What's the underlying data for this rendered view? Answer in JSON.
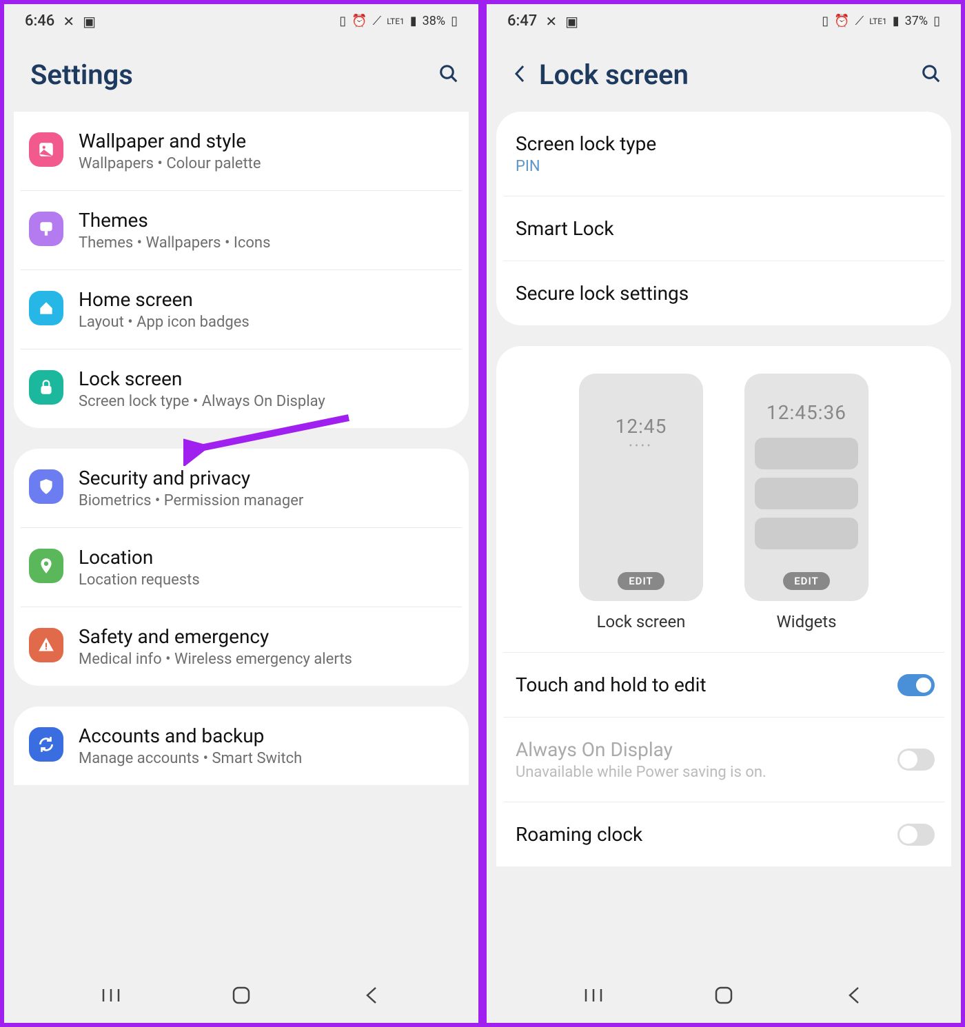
{
  "left": {
    "status": {
      "time": "6:46",
      "battery": "38%",
      "net": "LTE1"
    },
    "header": {
      "title": "Settings"
    },
    "group1": [
      {
        "title": "Wallpaper and style",
        "sub": "Wallpapers  •  Colour palette",
        "color": "#f25a8e",
        "icon": "picture"
      },
      {
        "title": "Themes",
        "sub": "Themes  •  Wallpapers  •  Icons",
        "color": "#b47af0",
        "icon": "brush"
      },
      {
        "title": "Home screen",
        "sub": "Layout  •  App icon badges",
        "color": "#26b7e6",
        "icon": "home"
      },
      {
        "title": "Lock screen",
        "sub": "Screen lock type  •  Always On Display",
        "color": "#1bb89e",
        "icon": "lock",
        "arrow": true
      }
    ],
    "group2": [
      {
        "title": "Security and privacy",
        "sub": "Biometrics  •  Permission manager",
        "color": "#6b7df0",
        "icon": "shield"
      },
      {
        "title": "Location",
        "sub": "Location requests",
        "color": "#5ab85a",
        "icon": "pin"
      },
      {
        "title": "Safety and emergency",
        "sub": "Medical info  •  Wireless emergency alerts",
        "color": "#e06a4a",
        "icon": "alert"
      }
    ],
    "group3": [
      {
        "title": "Accounts and backup",
        "sub": "Manage accounts  •  Smart Switch",
        "color": "#3a6de0",
        "icon": "sync"
      }
    ]
  },
  "right": {
    "status": {
      "time": "6:47",
      "battery": "37%",
      "net": "LTE1"
    },
    "header": {
      "title": "Lock screen"
    },
    "group1": [
      {
        "title": "Screen lock type",
        "sub": "PIN",
        "arrow": true
      },
      {
        "title": "Smart Lock"
      },
      {
        "title": "Secure lock settings"
      }
    ],
    "previews": {
      "left": {
        "time": "12:45",
        "label": "Lock screen",
        "edit": "EDIT"
      },
      "right": {
        "time": "12:45:36",
        "label": "Widgets",
        "edit": "EDIT"
      }
    },
    "group3": [
      {
        "title": "Touch and hold to edit",
        "toggle": "on"
      },
      {
        "title": "Always On Display",
        "sub": "Unavailable while Power saving is on.",
        "toggle": "off",
        "disabled": true
      },
      {
        "title": "Roaming clock",
        "toggle": "off"
      }
    ]
  }
}
